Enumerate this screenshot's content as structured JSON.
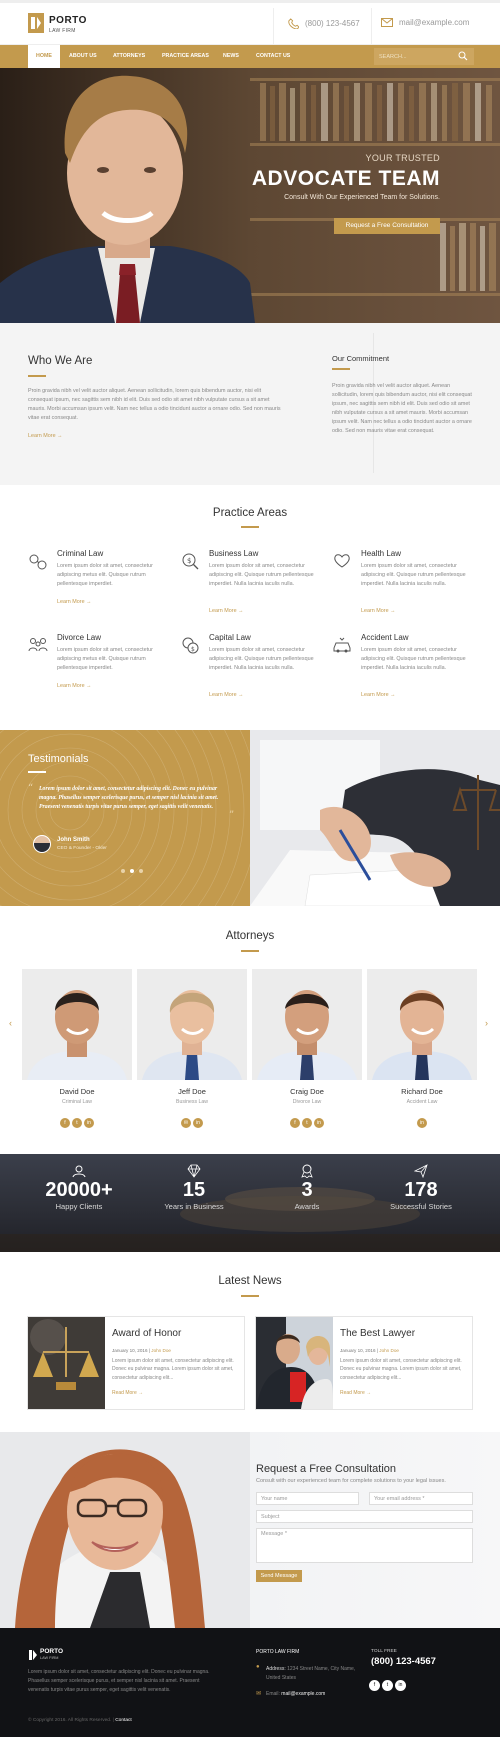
{
  "brand": {
    "name": "PORTO",
    "sub": "LAW FIRM"
  },
  "header": {
    "phone": "(800) 123-4567",
    "email": "mail@example.com"
  },
  "nav": {
    "items": [
      "HOME",
      "ABOUT US",
      "ATTORNEYS",
      "PRACTICE AREAS",
      "NEWS",
      "CONTACT US"
    ],
    "search_placeholder": "SEARCH..."
  },
  "hero": {
    "pretitle": "YOUR TRUSTED",
    "title": "ADVOCATE TEAM",
    "subtitle": "Consult With Our Experienced Team for Solutions.",
    "button": "Request a Free Consultation"
  },
  "who": {
    "title": "Who We Are",
    "text": "Proin gravida nibh vel velit auctor aliquet. Aenean sollicitudin, lorem quis bibendum auctor, nisi elit consequat ipsum, nec sagittis sem nibh id elit. Duis sed odio sit amet nibh vulputate cursus a sit amet mauris. Morbi accumsan ipsum velit. Nam nec tellus a odio tincidunt auctor a ornare odio. Sed non mauris vitae erat consequat.",
    "learn": "Learn More →",
    "commit_title": "Our Commitment",
    "commit_text": "Proin gravida nibh vel velit auctor aliquet. Aenean sollicitudin, lorem quis bibendum auctor, nisi elit consequat ipsum, nec sagittis sem nibh id elit. Duis sed odio sit amet nibh vulputate cursus a sit amet mauris. Morbi accumsan ipsum velit. Nam nec tellus a odio tincidunt auctor a ornare odio. Sed non mauris vitae erat consequat."
  },
  "practice": {
    "title": "Practice Areas",
    "learn": "Learn More →",
    "items": [
      {
        "title": "Criminal Law",
        "text": "Lorem ipsum dolor sit amet, consectetur adipiscing metus elit. Quisque rutrum pellentesque imperdiet.",
        "icon": "handcuffs-icon"
      },
      {
        "title": "Business Law",
        "text": "Lorem ipsum dolor sit amet, consectetur adipiscing elit. Quisque rutrum pellentesque imperdiet. Nulla lacinia iaculis nulla.",
        "icon": "money-search-icon"
      },
      {
        "title": "Health Law",
        "text": "Lorem ipsum dolor sit amet, consectetur adipiscing elit. Quisque rutrum pellentesque imperdiet. Nulla lacinia iaculis nulla.",
        "icon": "heart-hands-icon"
      },
      {
        "title": "Divorce Law",
        "text": "Lorem ipsum dolor sit amet, consectetur adipiscing metus elit. Quisque rutrum pellentesque imperdiet.",
        "icon": "family-icon"
      },
      {
        "title": "Capital Law",
        "text": "Lorem ipsum dolor sit amet, consectetur adipiscing elit. Quisque rutrum pellentesque imperdiet. Nulla lacinia iaculis nulla.",
        "icon": "coins-icon"
      },
      {
        "title": "Accident Law",
        "text": "Lorem ipsum dolor sit amet, consectetur adipiscing elit. Quisque rutrum pellentesque imperdiet. Nulla lacinia iaculis nulla.",
        "icon": "car-crash-icon"
      }
    ]
  },
  "testimonials": {
    "title": "Testimonials",
    "quote": "Lorem ipsum dolor sit amet, consectetur adipiscing elit. Donec eu pulvinar magna. Phasellus semper scelerisque purus, et semper nisl lacinia sit amet. Praesent venenatis turpis vitae purus semper, eget sagittis velit venenatis.",
    "author": "John Smith",
    "role": "CEO & Founder - Okler"
  },
  "attorneys": {
    "title": "Attorneys",
    "items": [
      {
        "name": "David Doe",
        "role": "Criminal Law",
        "social": [
          "f",
          "t",
          "in"
        ]
      },
      {
        "name": "Jeff Doe",
        "role": "Business Law",
        "social": [
          "✉",
          "in"
        ]
      },
      {
        "name": "Craig Doe",
        "role": "Divorce Law",
        "social": [
          "f",
          "t",
          "in"
        ]
      },
      {
        "name": "Richard Doe",
        "role": "Accident Law",
        "social": [
          "in"
        ]
      }
    ]
  },
  "stats": [
    {
      "num": "20000+",
      "label": "Happy Clients",
      "icon": "user-icon"
    },
    {
      "num": "15",
      "label": "Years in Business",
      "icon": "diamond-icon"
    },
    {
      "num": "3",
      "label": "Awards",
      "icon": "award-icon"
    },
    {
      "num": "178",
      "label": "Successful Stories",
      "icon": "paper-plane-icon"
    }
  ],
  "news": {
    "title": "Latest News",
    "items": [
      {
        "title": "Award of Honor",
        "date": "January 10, 2016",
        "author": "John Doe",
        "text": "Lorem ipsum dolor sit amet, consectetur adipiscing elit. Donec eu pulvinar magna. Lorem ipsum dolor sit amet, consectetur adipiscing elit...",
        "more": "Read More →"
      },
      {
        "title": "The Best Lawyer",
        "date": "January 10, 2016",
        "author": "John Doe",
        "text": "Lorem ipsum dolor sit amet, consectetur adipiscing elit. Donec eu pulvinar magna. Lorem ipsum dolor sit amet, consectetur adipiscing elit...",
        "more": "Read More →"
      }
    ]
  },
  "consult": {
    "title": "Request a Free Consultation",
    "subtitle": "Consult with our experienced team for complete solutions to your legal issues.",
    "name_ph": "Your name",
    "email_ph": "Your email address *",
    "subject_ph": "Subject",
    "message_ph": "Message *",
    "button": "Send Message"
  },
  "footer": {
    "about": "Lorem ipsum dolor sit amet, consectetur adipiscing elit. Donec eu pulvinar magna. Phasellus semper scelerisque purus, et semper nisl lacinia sit amet. Praesent venenatis turpis vitae purus semper, eget sagittis velit venenatis.",
    "office_title": "PORTO LAW FIRM",
    "address_label": "Address:",
    "address": "1234 Street Name, City Name, United States",
    "email_label": "Email:",
    "email": "mail@example.com",
    "tollfree_label": "TOLL FREE",
    "phone": "(800) 123-4567",
    "copyright": "© Copyright 2016. All Rights Reserved.",
    "contact_link": "Contact"
  },
  "colors": {
    "accent": "#c39a4d",
    "dark": "#111215"
  }
}
